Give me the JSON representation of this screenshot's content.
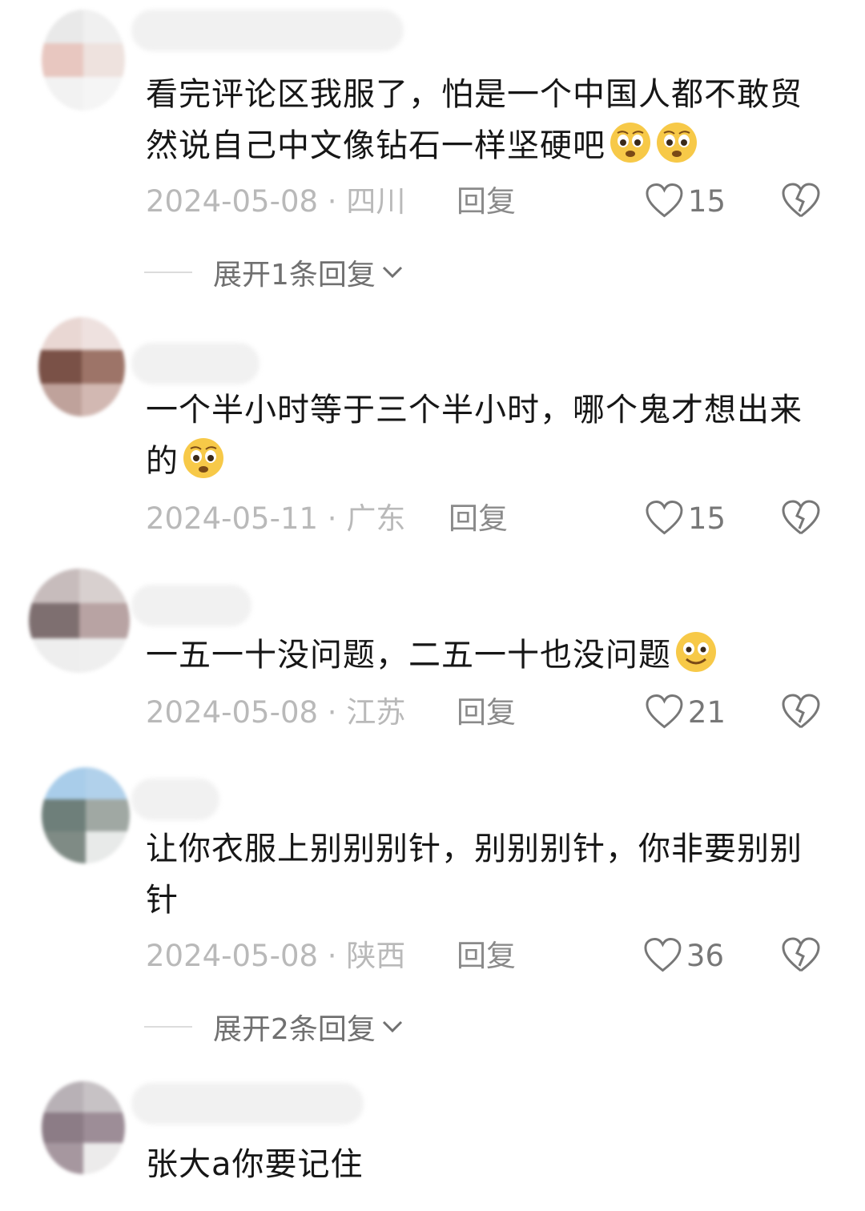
{
  "comments": [
    {
      "text": "看完评论区我服了，怕是一个中国人都不敢贸然说自己中文像钻石一样坚硬吧",
      "emoji": [
        "pleading-face-icon",
        "pleading-face-icon"
      ],
      "date": "2024-05-08",
      "region": "四川",
      "reply_label": "回复",
      "likes": "15",
      "expand": "展开1条回复"
    },
    {
      "text": "一个半小时等于三个半小时，哪个鬼才想出来的",
      "emoji": [
        "pleading-face-icon"
      ],
      "date": "2024-05-11",
      "region": "广东",
      "reply_label": "回复",
      "likes": "15"
    },
    {
      "text": "一五一十没问题，二五一十也没问题",
      "emoji": [
        "smiling-face-icon"
      ],
      "date": "2024-05-08",
      "region": "江苏",
      "reply_label": "回复",
      "likes": "21"
    },
    {
      "text": "让你衣服上别别别针，别别别针，你非要别别针",
      "emoji": [],
      "date": "2024-05-08",
      "region": "陕西",
      "reply_label": "回复",
      "likes": "36",
      "expand": "展开2条回复"
    },
    {
      "text": "张大a你要记住",
      "emoji": []
    }
  ],
  "colors": {
    "text": "#161616",
    "meta": "#b9b9b9",
    "reply": "#8a8a8a",
    "emoji_face": "#f7c948"
  }
}
